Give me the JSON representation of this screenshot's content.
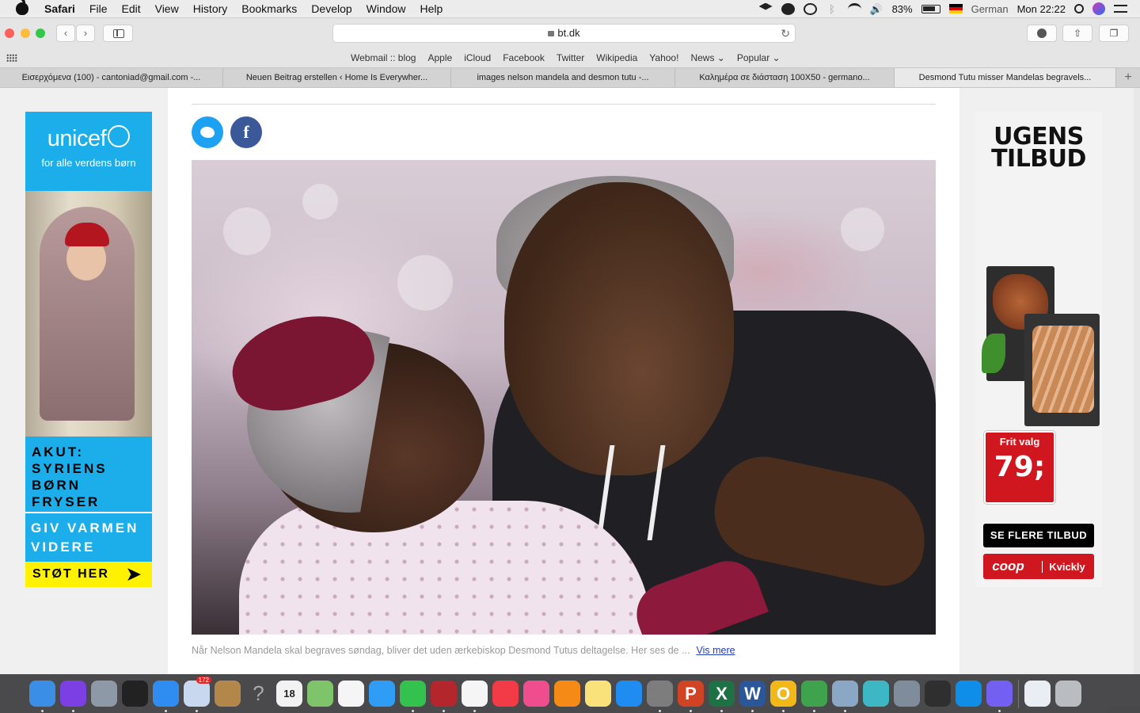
{
  "menubar": {
    "app_name": "Safari",
    "items": [
      "File",
      "Edit",
      "View",
      "History",
      "Bookmarks",
      "Develop",
      "Window",
      "Help"
    ],
    "battery": "83%",
    "input_language": "German",
    "clock": "Mon 22:22"
  },
  "toolbar": {
    "url": "bt.dk"
  },
  "bookmarks": [
    "Webmail :: blog",
    "Apple",
    "iCloud",
    "Facebook",
    "Twitter",
    "Wikipedia",
    "Yahoo!",
    "News ⌄",
    "Popular ⌄"
  ],
  "tabs": [
    {
      "label": "Εισερχόμενα (100) - cantoniad@gmail.com -...",
      "active": false
    },
    {
      "label": "Neuen Beitrag erstellen ‹ Home Is Everywher...",
      "active": false
    },
    {
      "label": "images nelson mandela and desmon tutu -...",
      "active": false
    },
    {
      "label": "Καλημέρα σε διάσταση 100X50 - germano...",
      "active": false
    },
    {
      "label": "Desmond Tutu misser Mandelas begravels...",
      "active": true
    }
  ],
  "article": {
    "social": {
      "twitter": "twitter-icon",
      "facebook_glyph": "f"
    },
    "caption": "Når Nelson Mandela skal begraves søndag, bliver det uden ærkebiskop Desmond Tutus deltagelse. Her ses de ...",
    "more_link": "Vis mere"
  },
  "ad_left": {
    "brand": "unicef",
    "tagline": "for alle verdens børn",
    "headline": "AKUT: SYRIENS BØRN FRYSER",
    "subline": "GIV VARMEN VIDERE",
    "cta": "STØT HER",
    "colors": {
      "blue": "#1caeea",
      "yellow": "#fff200"
    }
  },
  "ad_right": {
    "title": "UGENS TILBUD",
    "price_label": "Frit valg",
    "price": "79;",
    "cta": "SE FLERE TILBUD",
    "logo_coop": "coop",
    "logo_kvickly": "Kvickly",
    "colors": {
      "red": "#d0161f"
    }
  },
  "dock": {
    "apps": [
      {
        "name": "finder-icon",
        "color": "#3a8ee6",
        "glyph": ""
      },
      {
        "name": "siri-icon",
        "color": "#7b3fe4",
        "glyph": ""
      },
      {
        "name": "launchpad-icon",
        "color": "#8d99a6",
        "glyph": ""
      },
      {
        "name": "activity-monitor-icon",
        "color": "#222222",
        "glyph": ""
      },
      {
        "name": "safari-icon",
        "color": "#2f8cf0",
        "glyph": ""
      },
      {
        "name": "mail-stamp-icon",
        "color": "#c8d8ee",
        "glyph": "",
        "badge": "172"
      },
      {
        "name": "contacts-icon",
        "color": "#b3874a",
        "glyph": ""
      },
      {
        "name": "help-icon",
        "color": "#555555",
        "glyph": "?"
      },
      {
        "name": "calendar-icon",
        "color": "#f2f2f2",
        "glyph": "18"
      },
      {
        "name": "maps-icon",
        "color": "#7fc36a",
        "glyph": ""
      },
      {
        "name": "reminders-icon",
        "color": "#f5f5f5",
        "glyph": ""
      },
      {
        "name": "messages-icon",
        "color": "#2f9cf5",
        "glyph": ""
      },
      {
        "name": "facetime-icon",
        "color": "#33c24d",
        "glyph": ""
      },
      {
        "name": "photo-booth-icon",
        "color": "#b2262c",
        "glyph": ""
      },
      {
        "name": "photos-icon",
        "color": "#f5f5f5",
        "glyph": ""
      },
      {
        "name": "news-icon",
        "color": "#f23b47",
        "glyph": ""
      },
      {
        "name": "itunes-icon",
        "color": "#f04d8f",
        "glyph": ""
      },
      {
        "name": "books-icon",
        "color": "#f58a17",
        "glyph": ""
      },
      {
        "name": "notes-icon",
        "color": "#f9e27a",
        "glyph": ""
      },
      {
        "name": "app-store-icon",
        "color": "#1f8cf2",
        "glyph": ""
      },
      {
        "name": "system-preferences-icon",
        "color": "#7d7d7d",
        "glyph": ""
      },
      {
        "name": "powerpoint-icon",
        "color": "#d04423",
        "glyph": "P"
      },
      {
        "name": "excel-icon",
        "color": "#1e7145",
        "glyph": "X"
      },
      {
        "name": "word-icon",
        "color": "#2b579a",
        "glyph": "W"
      },
      {
        "name": "outlook-icon",
        "color": "#f2b818",
        "glyph": "O"
      },
      {
        "name": "network-globe-icon",
        "color": "#3fa34d",
        "glyph": ""
      },
      {
        "name": "preview-icon",
        "color": "#8aa7c5",
        "glyph": ""
      },
      {
        "name": "family-sharing-icon",
        "color": "#3db7c4",
        "glyph": ""
      },
      {
        "name": "image-capture-icon",
        "color": "#7e8c9c",
        "glyph": ""
      },
      {
        "name": "screen-sharing-icon",
        "color": "#2f2f2f",
        "glyph": ""
      },
      {
        "name": "teamviewer-icon",
        "color": "#0e8ee9",
        "glyph": ""
      },
      {
        "name": "viber-icon",
        "color": "#7360f2",
        "glyph": ""
      },
      {
        "name": "word-document-icon",
        "color": "#e9eef5",
        "glyph": ""
      },
      {
        "name": "trash-icon",
        "color": "#b9bcc0",
        "glyph": ""
      }
    ]
  }
}
